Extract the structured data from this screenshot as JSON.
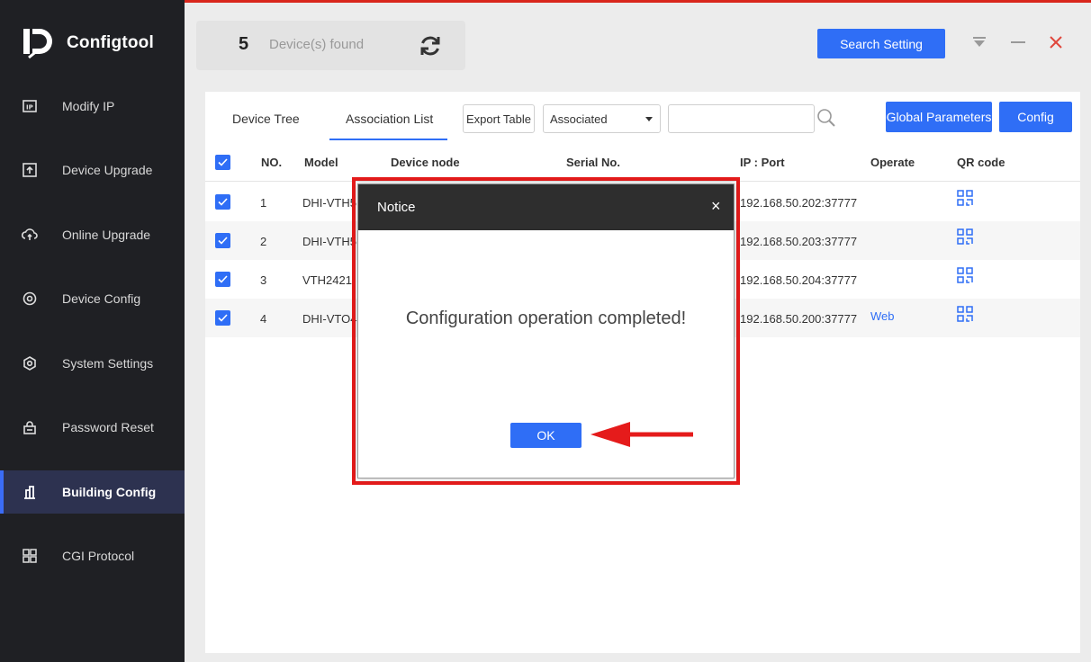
{
  "app": {
    "name": "Configtool"
  },
  "sidebar": {
    "items": [
      {
        "label": "Modify IP",
        "icon": "modify-ip-icon"
      },
      {
        "label": "Device Upgrade",
        "icon": "upgrade-icon"
      },
      {
        "label": "Online Upgrade",
        "icon": "cloud-upgrade-icon"
      },
      {
        "label": "Device Config",
        "icon": "device-config-icon"
      },
      {
        "label": "System Settings",
        "icon": "settings-icon"
      },
      {
        "label": "Password Reset",
        "icon": "lock-icon"
      },
      {
        "label": "Building Config",
        "icon": "building-icon",
        "active": true
      },
      {
        "label": "CGI Protocol",
        "icon": "cgi-icon"
      }
    ]
  },
  "header": {
    "device_count": "5",
    "found_label": "Device(s) found",
    "search_setting_label": "Search Setting"
  },
  "toolbar": {
    "tabs": [
      "Device Tree",
      "Association List"
    ],
    "active_tab": "Association List",
    "export_label": "Export Table",
    "filter_value": "Associated",
    "search_value": "",
    "global_params_label": "Global Parameters",
    "config_label": "Config"
  },
  "table": {
    "columns": [
      "NO.",
      "Model",
      "Device node",
      "Serial No.",
      "IP : Port",
      "Operate",
      "QR code"
    ],
    "rows": [
      {
        "no": "1",
        "model": "DHI-VTH5",
        "ip": "192.168.50.202:37777",
        "operate": ""
      },
      {
        "no": "2",
        "model": "DHI-VTH5",
        "ip": "192.168.50.203:37777",
        "operate": ""
      },
      {
        "no": "3",
        "model": "VTH2421",
        "ip": "192.168.50.204:37777",
        "operate": ""
      },
      {
        "no": "4",
        "model": "DHI-VTO4",
        "ip": "192.168.50.200:37777",
        "operate": "Web"
      }
    ]
  },
  "modal": {
    "title": "Notice",
    "close": "×",
    "message": "Configuration operation completed!",
    "ok_label": "OK"
  },
  "colors": {
    "accent": "#2f6ef6",
    "sidebar_bg": "#1f2024",
    "highlight": "#e51b1b"
  }
}
